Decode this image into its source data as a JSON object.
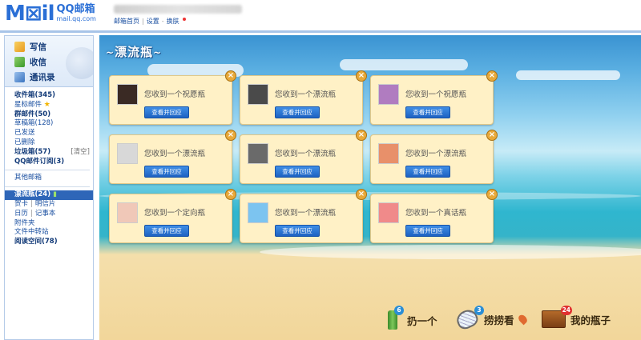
{
  "header": {
    "logo_mark": "M⊠il",
    "logo_cn": "QQ邮箱",
    "logo_url": "mail.qq.com",
    "links": [
      "邮箱首页",
      "设置",
      "换肤"
    ]
  },
  "sidebar": {
    "quick": [
      "写信",
      "收信",
      "通讯录"
    ],
    "folders_main": [
      {
        "label": "收件箱(345)",
        "bold": true
      },
      {
        "label": "星标邮件",
        "bold": false,
        "star": "★"
      },
      {
        "label": "群邮件(50)",
        "bold": true
      },
      {
        "label": "草稿箱(128)",
        "bold": false
      },
      {
        "label": "已发送",
        "bold": false
      },
      {
        "label": "已删除",
        "bold": false
      },
      {
        "label": "垃圾箱(57)",
        "bold": true,
        "action": "[清空]"
      },
      {
        "label": "QQ邮件订阅(3)",
        "bold": true
      }
    ],
    "other_mailbox": "其他邮箱",
    "bottle_item": "漂流瓶(24)",
    "extras": [
      {
        "left": "贺卡",
        "right": "明信片"
      },
      {
        "left": "日历",
        "right": "记事本"
      },
      {
        "left": "附件夹"
      },
      {
        "left": "文件中转站"
      },
      {
        "left": "阅读空间(78)",
        "bold": true
      }
    ]
  },
  "main": {
    "title": "漂流瓶",
    "button_label": "查看并回应",
    "close_glyph": "×",
    "cards": [
      {
        "text": "您收到一个祝愿瓶",
        "avatar_color": "#3a2a24"
      },
      {
        "text": "您收到一个漂流瓶",
        "avatar_color": "#4a4a4a"
      },
      {
        "text": "您收到一个祝愿瓶",
        "avatar_color": "#b07cc0"
      },
      {
        "text": "您收到一个漂流瓶",
        "avatar_color": "#d8d8d8"
      },
      {
        "text": "您收到一个漂流瓶",
        "avatar_color": "#6a6a6a"
      },
      {
        "text": "您收到一个漂流瓶",
        "avatar_color": "#e8906a"
      },
      {
        "text": "您收到一个定向瓶",
        "avatar_color": "#f0c8b8"
      },
      {
        "text": "您收到一个漂流瓶",
        "avatar_color": "#7cc4f0"
      },
      {
        "text": "您收到一个真话瓶",
        "avatar_color": "#f08a8a"
      }
    ],
    "actions": [
      {
        "label": "扔一个",
        "badge": "6"
      },
      {
        "label": "捞捞看",
        "badge": "3"
      },
      {
        "label": "我的瓶子",
        "badge": "24"
      }
    ]
  }
}
